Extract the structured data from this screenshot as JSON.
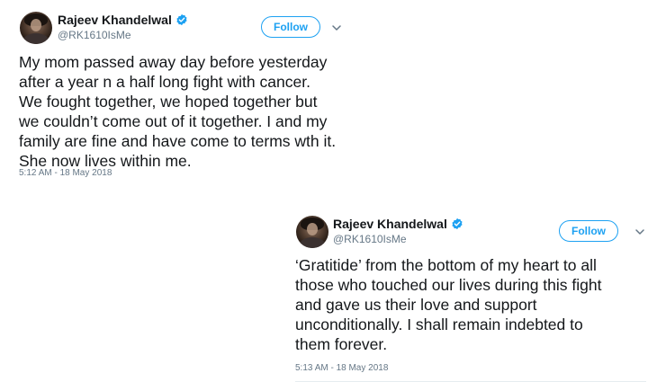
{
  "tweets": [
    {
      "name": "Rajeev Khandelwal",
      "handle": "@RK1610IsMe",
      "follow_label": "Follow",
      "text_lines": [
        "My mom passed away day before yesterday",
        "after a year n a half long fight with cancer.",
        "We fought together, we hoped together but",
        "we couldn’t come out of it together. I and my",
        "family are fine and have come to terms wth it.",
        "She now lives within me."
      ],
      "timestamp": "5:12 AM - 18 May 2018"
    },
    {
      "name": "Rajeev Khandelwal",
      "handle": "@RK1610IsMe",
      "follow_label": "Follow",
      "text_lines": [
        "‘Gratitide’ from the bottom of my heart to all",
        "those who touched our lives during this fight",
        "and gave us their love and support",
        "unconditionally. I shall remain indebted to",
        "them forever."
      ],
      "timestamp": "5:13 AM - 18 May 2018"
    }
  ],
  "icons": {
    "verified": "verified-badge-icon",
    "caret": "chevron-down-icon",
    "avatar": "profile-photo"
  },
  "colors": {
    "brand_blue": "#1da1f2",
    "text": "#14171a",
    "secondary": "#657786"
  }
}
